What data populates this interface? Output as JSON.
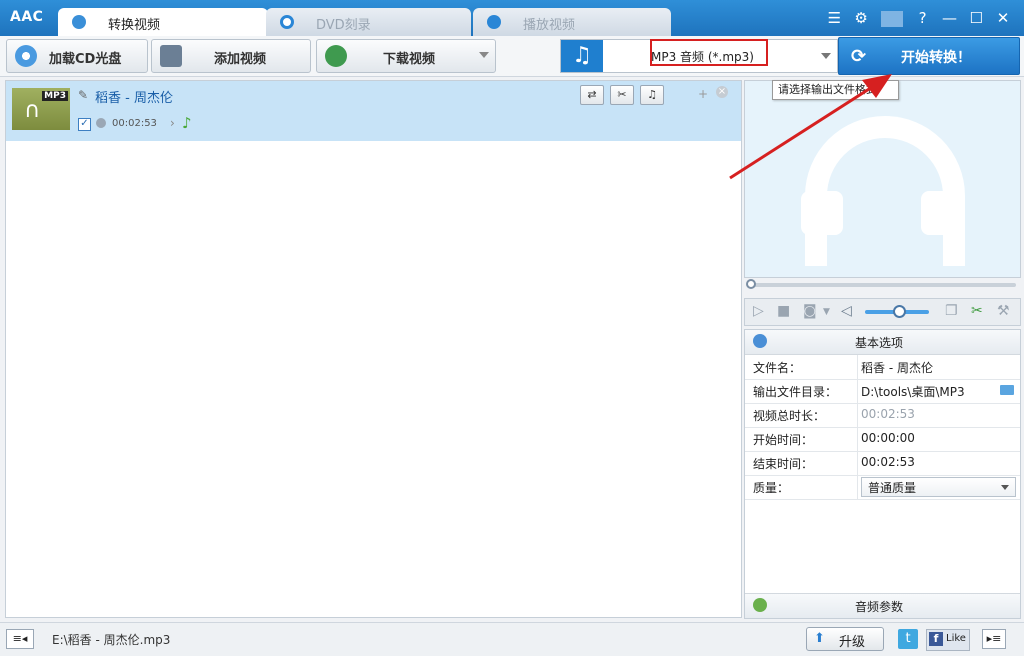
{
  "app": {
    "logo": "AAC"
  },
  "tabs": [
    {
      "label": "转换视频",
      "active": true
    },
    {
      "label": "DVD刻录",
      "active": false
    },
    {
      "label": "播放视频",
      "active": false
    }
  ],
  "window_controls": {
    "menu": "☰",
    "settings": "⚙",
    "help": "?",
    "minimize": "—",
    "maximize": "☐",
    "close": "✕"
  },
  "toolbar": {
    "load_cd": "加载CD光盘",
    "add_video": "添加视频",
    "download_video": "下载视频",
    "format_selected": "MP3 音频 (*.mp3)",
    "start_convert": "开始转换！"
  },
  "tooltip": "请选择输出文件格式",
  "file_list": [
    {
      "name": "稻香 - 周杰伦",
      "duration": "00:02:53",
      "badge": "MP3",
      "checked": true
    }
  ],
  "properties": {
    "header": "基本选项",
    "rows": [
      {
        "key": "文件名：",
        "value": "稻香 - 周杰伦"
      },
      {
        "key": "输出文件目录：",
        "value": "D:\\tools\\桌面\\MP3"
      },
      {
        "key": "视频总时长：",
        "value": "00:02:53"
      },
      {
        "key": "开始时间：",
        "value": "00:00:00"
      },
      {
        "key": "结束时间：",
        "value": "00:02:53"
      },
      {
        "key": "质量：",
        "value": "普通质量"
      }
    ],
    "footer": "音频参数"
  },
  "status": {
    "path": "E:\\稻香 - 周杰伦.mp3",
    "upgrade": "升级",
    "like": "Like"
  },
  "colors": {
    "accent": "#1e73bd",
    "highlight": "#d62020",
    "selected_row": "#c7e3f7"
  }
}
